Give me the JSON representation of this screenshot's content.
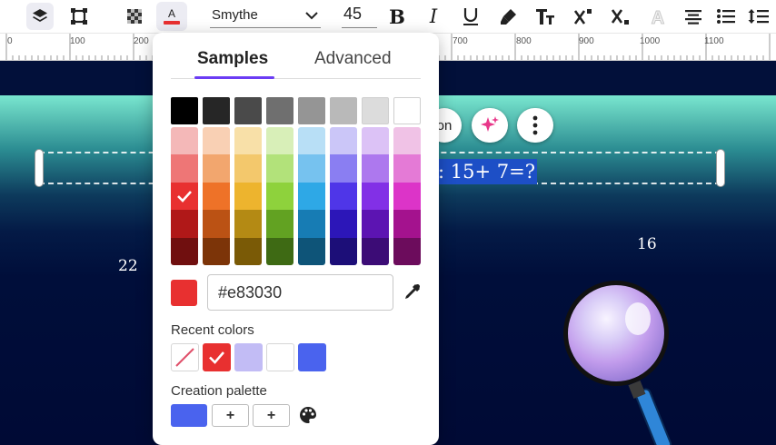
{
  "toolbar": {
    "font_name": "Smythe",
    "font_size": "45",
    "text_color": "#e83030",
    "icons": [
      "layers-icon",
      "crop-frame-icon",
      "transparency-icon",
      "text-color-icon",
      "bold-icon",
      "italic-icon",
      "underline-icon",
      "highlighter-icon",
      "text-case-icon",
      "superscript-icon",
      "subscript-icon",
      "text-effect-icon",
      "align-center-icon",
      "bullet-list-icon",
      "line-spacing-icon"
    ]
  },
  "ruler": {
    "ticks": [
      "0",
      "100",
      "200",
      "700",
      "800",
      "900",
      "1000",
      "1100"
    ]
  },
  "canvas": {
    "equation_text": ": 15+ 7=?",
    "left_number": "22",
    "right_number": "16",
    "partial_button_text": "on"
  },
  "color_panel": {
    "tabs": [
      "Samples",
      "Advanced"
    ],
    "active_tab": "Samples",
    "grays": [
      "#000000",
      "#262626",
      "#4a4a4a",
      "#6f6f6f",
      "#959595",
      "#b9b9b9",
      "#dcdcdc",
      "#ffffff"
    ],
    "grid": [
      [
        "#f4b8b8",
        "#ee7676",
        "#e83030",
        "#b01818",
        "#700f0f"
      ],
      [
        "#f9d0b4",
        "#f2a66e",
        "#ee7228",
        "#bb5214",
        "#7c3408"
      ],
      [
        "#f8e0a8",
        "#f3c86c",
        "#edb42e",
        "#b48a14",
        "#7a5a06"
      ],
      [
        "#d8efb8",
        "#b2e27a",
        "#8ed23c",
        "#62a222",
        "#3e6a14"
      ],
      [
        "#b8dff6",
        "#76c2ef",
        "#2ea8e6",
        "#177cb4",
        "#0e5478"
      ],
      [
        "#cbc6f8",
        "#8a7ef2",
        "#4f36e8",
        "#2c16b8",
        "#1c0e78"
      ],
      [
        "#dcc2f6",
        "#ad78ee",
        "#8230e6",
        "#5c14b2",
        "#3c0c76"
      ],
      [
        "#f0c2e6",
        "#e47ad6",
        "#dc34c8",
        "#a4128e",
        "#6c0c5c"
      ]
    ],
    "selected_cell": [
      0,
      2
    ],
    "current_color": "#e83030",
    "hex_value": "#e83030",
    "recent_label": "Recent colors",
    "recent_colors": [
      "none",
      "#e83030",
      "#c2bcf5",
      "#ffffff",
      "#4a63ee"
    ],
    "creation_label": "Creation palette",
    "creation_colors": [
      "#4a63ee"
    ],
    "add_label": "+"
  }
}
